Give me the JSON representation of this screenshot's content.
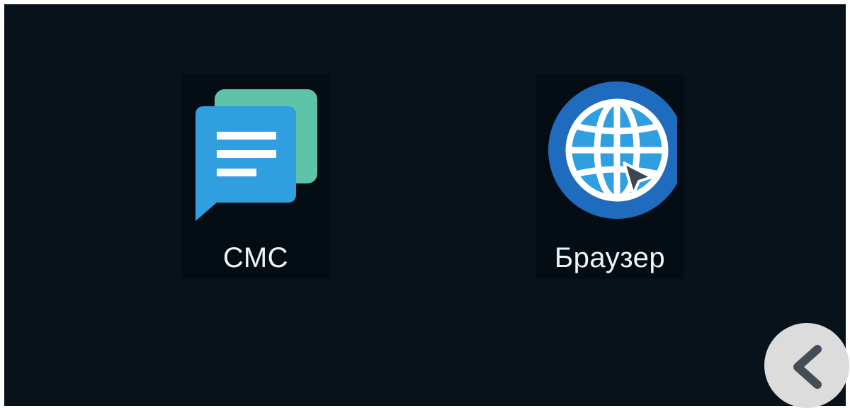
{
  "home_screen": {
    "apps": [
      {
        "label": "СМС",
        "icon": "message-bubbles-icon"
      },
      {
        "label": "Браузер",
        "icon": "globe-cursor-icon"
      }
    ]
  },
  "navigation": {
    "back_icon": "chevron-left-icon"
  },
  "colors": {
    "background": "#08121b",
    "sms_front": "#2f9fe0",
    "sms_back": "#5fc3a8",
    "browser_ring": "#1f6bbd",
    "browser_globe": "#2f9fe0",
    "back_button": "#dcdcdc"
  }
}
